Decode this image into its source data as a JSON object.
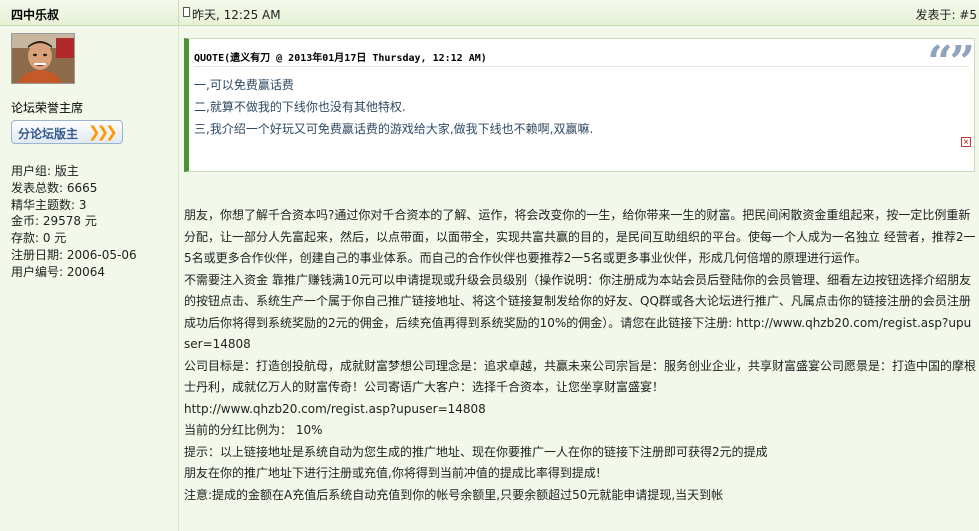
{
  "header": {
    "username": "四中乐叔",
    "post_time": "昨天, 12:25 AM",
    "posted_at": "发表于: #5"
  },
  "sidebar": {
    "avatar": "avatar",
    "title": "论坛荣誉主席",
    "badge": {
      "label": "分论坛版主",
      "arrows": "❯❯❯"
    },
    "stats": [
      "用户组: 版主",
      "发表总数: 6665",
      "精华主题数: 3",
      "金币: 29578 元",
      "存款: 0 元",
      "注册日期: 2006-05-06",
      "用户编号: 20064"
    ]
  },
  "quote": {
    "header": "QUOTE(遗义有刀 @ 2013年01月17日 Thursday, 12:12 AM)",
    "icon": "quote-icon",
    "lines": [
      "一,可以免费赢话费",
      "二,就算不做我的下线你也没有其他特权.",
      "三,我介绍一个好玩又可免费赢话费的游戏给大家,做我下线也不赖啊,双赢嘛."
    ]
  },
  "body": {
    "p1": "朋友，你想了解千合资本吗?通过你对千合资本的了解、运作，将会改变你的一生，给你带来一生的财富。把民间闲散资金重组起来，按一定比例重新分配，让一部分人先富起来，然后，以点带面，以面带全，实现共富共赢的目的，是民间互助组织的平台。使每一个人成为一名独立 经营者，推荐2一5名或更多合作伙伴，创建自己的事业体系。而自己的合作伙伴也要推荐2一5名或更多事业伙伴，形成几何倍增的原理进行运作。",
    "p2": "不需要注入资金 靠推广赚钱满10元可以申请提现或升级会员级别（操作说明：你注册成为本站会员后登陆你的会员管理、细看左边按钮选择介绍朋友的按钮点击、系统生产一个属于你自己推广链接地址、将这个链接复制发给你的好友、QQ群或各大论坛进行推广、凡属点击你的链接注册的会员注册成功后你将得到系统奖励的2元的佣金，后续充值再得到系统奖励的10%的佣金）。请您在此链接下注册: http://www.qhzb20.com/regist.asp?upuser=14808",
    "p3": "公司目标是：打造创投航母，成就财富梦想公司理念是：追求卓越，共赢未来公司宗旨是：服务创业企业，共享财富盛宴公司愿景是：打造中国的摩根士丹利，成就亿万人的财富传奇！公司寄语广大客户：选择千合资本，让您坐享财富盛宴！",
    "p4": "http://www.qhzb20.com/regist.asp?upuser=14808",
    "p5": "当前的分红比例为： 10%",
    "p6": "提示：以上链接地址是系统自动为您生成的推广地址、现在你要推广一人在你的链接下注册即可获得2元的提成",
    "p7": "朋友在你的推广地址下进行注册或充值,你将得到当前冲值的提成比率得到提成!",
    "p8": "注意:提成的金额在A充值后系统自动充值到你的帐号余额里,只要余额超过50元就能申请提现,当天到帐"
  },
  "colors": {
    "accent": "#4e8f3a",
    "page_bg": "#f2f8ea",
    "badge_arrow": "#ff9900"
  }
}
